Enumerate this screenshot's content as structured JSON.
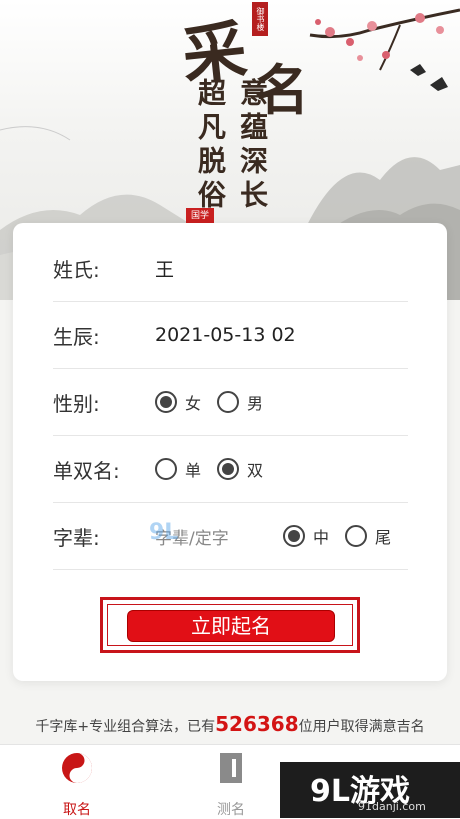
{
  "header": {
    "title_char_1": "采",
    "title_char_2": "名",
    "column_1": "超凡脱俗",
    "column_2": "意蕴深长",
    "stamp_text": "御书楼",
    "seal_text": "国学"
  },
  "form": {
    "surname": {
      "label": "姓氏:",
      "value": "王"
    },
    "birth": {
      "label": "生辰:",
      "value": "2021-05-13 02"
    },
    "gender": {
      "label": "性别:",
      "options": [
        "女",
        "男"
      ],
      "selected": "女"
    },
    "name_type": {
      "label": "单双名:",
      "options": [
        "单",
        "双"
      ],
      "selected": "双"
    },
    "zibei": {
      "label": "字辈:",
      "placeholder": "字辈/定字",
      "positions": [
        "中",
        "尾"
      ],
      "selected": "中"
    }
  },
  "submit_button": "立即起名",
  "promo": {
    "prefix": "千字库+专业组合算法，已有",
    "count": "526368",
    "suffix": "位用户取得满意吉名"
  },
  "tabs": [
    {
      "label": "取名",
      "icon": "yin-yang-icon",
      "active": true
    },
    {
      "label": "测名",
      "icon": "book-icon",
      "active": false
    }
  ],
  "watermark": {
    "logo": "9L游戏",
    "url": "91danji.com"
  },
  "colors": {
    "accent": "#e10f16",
    "text": "#333333"
  }
}
